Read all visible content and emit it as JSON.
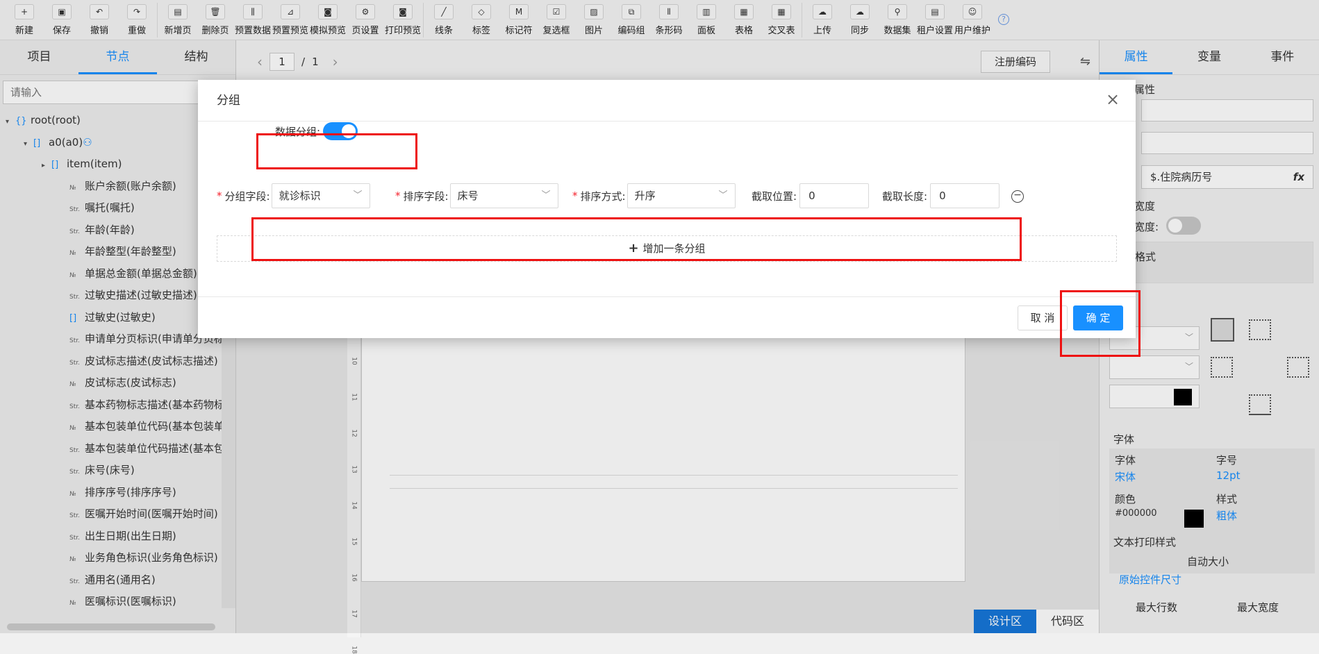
{
  "toolbar": {
    "items": [
      {
        "label": "新建",
        "icon": "new-file-icon",
        "glyph": "+"
      },
      {
        "label": "保存",
        "icon": "save-icon",
        "glyph": "▣"
      },
      {
        "label": "撤销",
        "icon": "undo-icon",
        "glyph": "↶"
      },
      {
        "label": "重做",
        "icon": "redo-icon",
        "glyph": "↷"
      },
      {
        "label": "新增页",
        "icon": "add-page-icon",
        "glyph": "▤"
      },
      {
        "label": "删除页",
        "icon": "delete-page-icon",
        "glyph": "🗑"
      },
      {
        "label": "预置数据",
        "icon": "preset-data-icon",
        "glyph": "⫼"
      },
      {
        "label": "预置预览",
        "icon": "preset-preview-icon",
        "glyph": "⊿"
      },
      {
        "label": "模拟预览",
        "icon": "simulate-preview-icon",
        "glyph": "◙"
      },
      {
        "label": "页设置",
        "icon": "page-settings-gear-icon",
        "glyph": "⚙"
      },
      {
        "label": "打印预览",
        "icon": "print-preview-icon",
        "glyph": "◙"
      },
      {
        "label": "线条",
        "icon": "line-icon",
        "glyph": "╱"
      },
      {
        "label": "标签",
        "icon": "label-tag-icon",
        "glyph": "◇"
      },
      {
        "label": "标记符",
        "icon": "marker-icon",
        "glyph": "M"
      },
      {
        "label": "复选框",
        "icon": "checkbox-icon",
        "glyph": "☑"
      },
      {
        "label": "图片",
        "icon": "image-icon",
        "glyph": "▨"
      },
      {
        "label": "编码组",
        "icon": "code-group-icon",
        "glyph": "⧉"
      },
      {
        "label": "条形码",
        "icon": "barcode-icon",
        "glyph": "⦀"
      },
      {
        "label": "面板",
        "icon": "panel-icon",
        "glyph": "▥"
      },
      {
        "label": "表格",
        "icon": "table-icon",
        "glyph": "▦"
      },
      {
        "label": "交叉表",
        "icon": "cross-table-icon",
        "glyph": "▦"
      },
      {
        "label": "上传",
        "icon": "upload-cloud-icon",
        "glyph": "☁"
      },
      {
        "label": "同步",
        "icon": "sync-cloud-icon",
        "glyph": "☁"
      },
      {
        "label": "数据集",
        "icon": "dataset-icon",
        "glyph": "⚲"
      },
      {
        "label": "租户设置",
        "icon": "tenant-settings-icon",
        "glyph": "▤"
      },
      {
        "label": "用户维护",
        "icon": "user-maintenance-icon",
        "glyph": "☺"
      }
    ],
    "help_glyph": "?"
  },
  "left_panel": {
    "tabs": [
      "项目",
      "节点",
      "结构"
    ],
    "active_tab": "节点",
    "search_placeholder": "请输入",
    "tree": [
      {
        "type": "{}",
        "label": "root(root)",
        "arrow": "▾",
        "indent": 0
      },
      {
        "type": "[]",
        "label": "a0(a0)",
        "arrow": "▾",
        "indent": 1,
        "extra": "⚇"
      },
      {
        "type": "[]",
        "label": "item(item)",
        "arrow": "▸",
        "indent": 2
      },
      {
        "type": "№",
        "label": "账户余额(账户余额)",
        "indent": 3
      },
      {
        "type": "Str.",
        "label": "嘱托(嘱托)",
        "indent": 3
      },
      {
        "type": "Str.",
        "label": "年龄(年龄)",
        "indent": 3
      },
      {
        "type": "№",
        "label": "年龄整型(年龄整型)",
        "indent": 3
      },
      {
        "type": "№",
        "label": "单据总金额(单据总金额)",
        "indent": 3
      },
      {
        "type": "Str.",
        "label": "过敏史描述(过敏史描述)",
        "indent": 3
      },
      {
        "type": "[]",
        "label": "过敏史(过敏史)",
        "indent": 3
      },
      {
        "type": "Str.",
        "label": "申请单分页标识(申请单分页标",
        "indent": 3
      },
      {
        "type": "Str.",
        "label": "皮试标志描述(皮试标志描述)",
        "indent": 3
      },
      {
        "type": "№",
        "label": "皮试标志(皮试标志)",
        "indent": 3
      },
      {
        "type": "Str.",
        "label": "基本药物标志描述(基本药物标",
        "indent": 3
      },
      {
        "type": "№",
        "label": "基本包装单位代码(基本包装单",
        "indent": 3
      },
      {
        "type": "Str.",
        "label": "基本包装单位代码描述(基本包",
        "indent": 3
      },
      {
        "type": "Str.",
        "label": "床号(床号)",
        "indent": 3
      },
      {
        "type": "№",
        "label": "排序序号(排序序号)",
        "indent": 3
      },
      {
        "type": "Str.",
        "label": "医嘱开始时间(医嘱开始时间)",
        "indent": 3
      },
      {
        "type": "Str.",
        "label": "出生日期(出生日期)",
        "indent": 3
      },
      {
        "type": "№",
        "label": "业务角色标识(业务角色标识)",
        "indent": 3
      },
      {
        "type": "Str.",
        "label": "通用名(通用名)",
        "indent": 3
      },
      {
        "type": "№",
        "label": "医嘱标识(医嘱标识)",
        "indent": 3
      }
    ]
  },
  "center": {
    "page_current": "1",
    "page_separator": "/",
    "page_total": "1",
    "prev": "‹",
    "next": "›",
    "register_button": "注册编码",
    "swap_icon": "⇋",
    "modes": [
      "设计区",
      "代码区"
    ],
    "active_mode": "设计区",
    "ruler_marks": [
      "9",
      "10",
      "11",
      "12",
      "13",
      "14",
      "15",
      "16",
      "17",
      "18"
    ]
  },
  "right_panel": {
    "tabs": [
      "属性",
      "变量",
      "事件"
    ],
    "active_tab": "属性",
    "section_attr": "属性",
    "field_value": "$.住院病历号",
    "fx": "fx",
    "width_section": "宽度",
    "width_label": "宽度:",
    "format_label": "格式",
    "font_section": "字体",
    "font_label": "字体",
    "font_value": "宋体",
    "size_label": "字号",
    "size_value": "12pt",
    "color_label": "颜色",
    "color_value": "#000000",
    "style_label": "样式",
    "style_value": "粗体",
    "print_style_section": "文本打印样式",
    "auto_size": "自动大小",
    "original_size": "原始控件尺寸",
    "max_rows": "最大行数",
    "max_width": "最大宽度"
  },
  "dialog": {
    "title": "分组",
    "close": "×",
    "data_group_label": "数据分组:",
    "data_group_on": true,
    "group_field_label": "分组字段:",
    "group_field_value": "就诊标识",
    "sort_field_label": "排序字段:",
    "sort_field_value": "床号",
    "sort_order_label": "排序方式:",
    "sort_order_value": "升序",
    "cut_pos_label": "截取位置:",
    "cut_pos_value": "0",
    "cut_len_label": "截取长度:",
    "cut_len_value": "0",
    "remove_glyph": "−",
    "add_group_label": "增加一条分组",
    "add_glyph": "+",
    "cancel_label": "取 消",
    "ok_label": "确 定"
  },
  "colors": {
    "accent": "#1890ff",
    "highlight": "#e11111",
    "required": "#f5222d"
  }
}
